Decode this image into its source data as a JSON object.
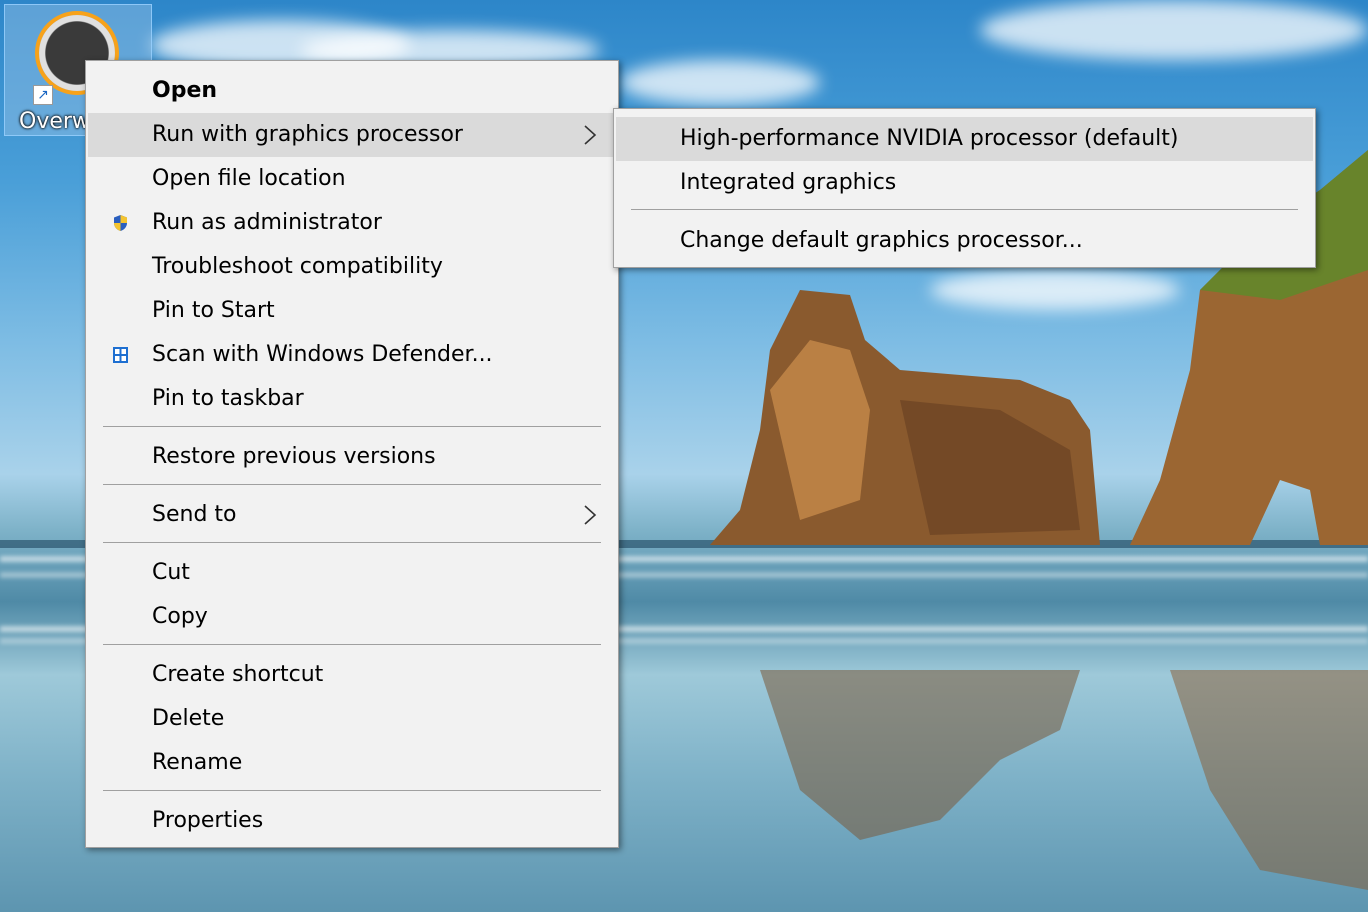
{
  "desktop": {
    "icon_label": "Overw"
  },
  "context_menu": {
    "items": [
      {
        "label": "Open"
      },
      {
        "label": "Run with graphics processor"
      },
      {
        "label": "Open file location"
      },
      {
        "label": "Run as administrator",
        "icon": "uac-shield-icon"
      },
      {
        "label": "Troubleshoot compatibility"
      },
      {
        "label": "Pin to Start"
      },
      {
        "label": "Scan with Windows Defender...",
        "icon": "windows-defender-icon"
      },
      {
        "label": "Pin to taskbar"
      },
      {
        "label": "Restore previous versions"
      },
      {
        "label": "Send to"
      },
      {
        "label": "Cut"
      },
      {
        "label": "Copy"
      },
      {
        "label": "Create shortcut"
      },
      {
        "label": "Delete"
      },
      {
        "label": "Rename"
      },
      {
        "label": "Properties"
      }
    ]
  },
  "submenu": {
    "items": [
      {
        "label": "High-performance NVIDIA processor (default)"
      },
      {
        "label": "Integrated graphics"
      },
      {
        "label": "Change default graphics processor..."
      }
    ]
  },
  "colors": {
    "menu_bg": "#f2f2f2",
    "hover_bg": "#dadada",
    "separator": "#a0a0a0",
    "accent_orange": "#f7a21a"
  }
}
